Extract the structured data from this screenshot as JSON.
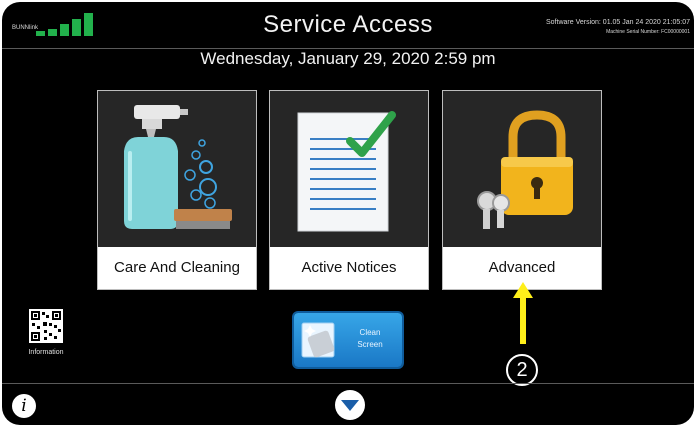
{
  "header": {
    "bunnlink_label": "BUNNlink",
    "title": "Service Access",
    "software_version": "Software Version: 01.05 Jan 24 2020 21:05:07",
    "serial_number": "Machine Serial Number: FC00000001",
    "signal_level": 5
  },
  "date_time": "Wednesday, January 29, 2020 2:59 pm",
  "tiles": [
    {
      "label": "Care And Cleaning"
    },
    {
      "label": "Active Notices"
    },
    {
      "label": "Advanced"
    }
  ],
  "information_label": "Information",
  "clean_screen": {
    "line1": "Clean",
    "line2": "Screen"
  },
  "bottom": {
    "info_glyph": "i"
  },
  "callout": {
    "number": "2"
  },
  "colors": {
    "accent_green": "#22b14c",
    "button_blue": "#2b8fdb",
    "callout_yellow": "#ffef1a"
  }
}
